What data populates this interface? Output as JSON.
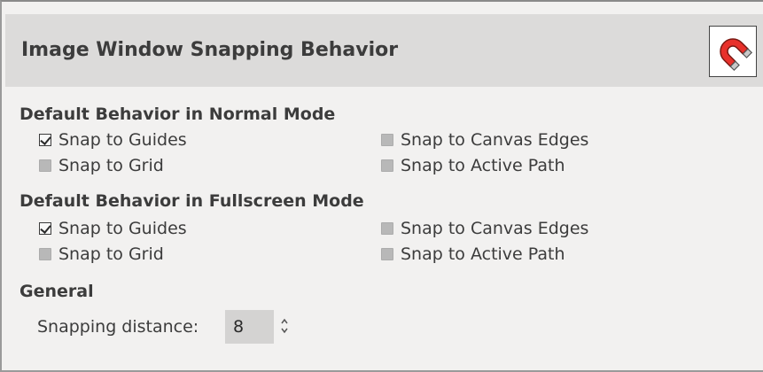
{
  "title": "Image Window Snapping Behavior",
  "icon": "snap-magnet-icon",
  "normal": {
    "heading": "Default Behavior in Normal Mode",
    "options": [
      {
        "label": "Snap to Guides",
        "checked": true
      },
      {
        "label": "Snap to Grid",
        "checked": false
      },
      {
        "label": "Snap to Canvas Edges",
        "checked": false
      },
      {
        "label": "Snap to Active Path",
        "checked": false
      }
    ]
  },
  "fullscreen": {
    "heading": "Default Behavior in Fullscreen Mode",
    "options": [
      {
        "label": "Snap to Guides",
        "checked": true
      },
      {
        "label": "Snap to Grid",
        "checked": false
      },
      {
        "label": "Snap to Canvas Edges",
        "checked": false
      },
      {
        "label": "Snap to Active Path",
        "checked": false
      }
    ]
  },
  "general": {
    "heading": "General",
    "snapping_distance_label": "Snapping distance:",
    "snapping_distance_value": "8"
  },
  "colors": {
    "magnet_red": "#e8312b",
    "magnet_tip": "#c8c8c8"
  }
}
